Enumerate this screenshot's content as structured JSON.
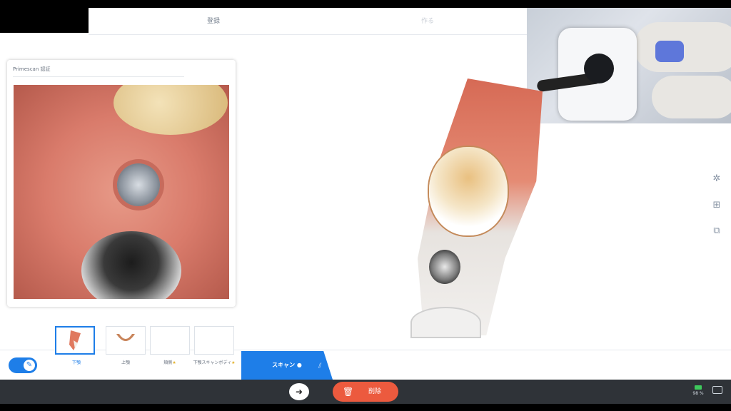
{
  "workflow": {
    "tabs": [
      {
        "label": "登録"
      },
      {
        "label": "光学印象"
      },
      {
        "label": "作る"
      }
    ]
  },
  "panel": {
    "title": "Primescan 認証"
  },
  "right_toolbar": {
    "icons": [
      "star-icon",
      "grid-icon",
      "export-icon"
    ]
  },
  "scan_thumbs": [
    {
      "label": "下顎",
      "active": true
    },
    {
      "label": "上顎",
      "active": false
    },
    {
      "label": "頬側",
      "active": false
    },
    {
      "label": "下顎スキャンボディ",
      "active": false
    }
  ],
  "scan_tab": {
    "label": "スキャン"
  },
  "bottom_bar": {
    "delete_label": "削除",
    "battery": "98 %"
  }
}
